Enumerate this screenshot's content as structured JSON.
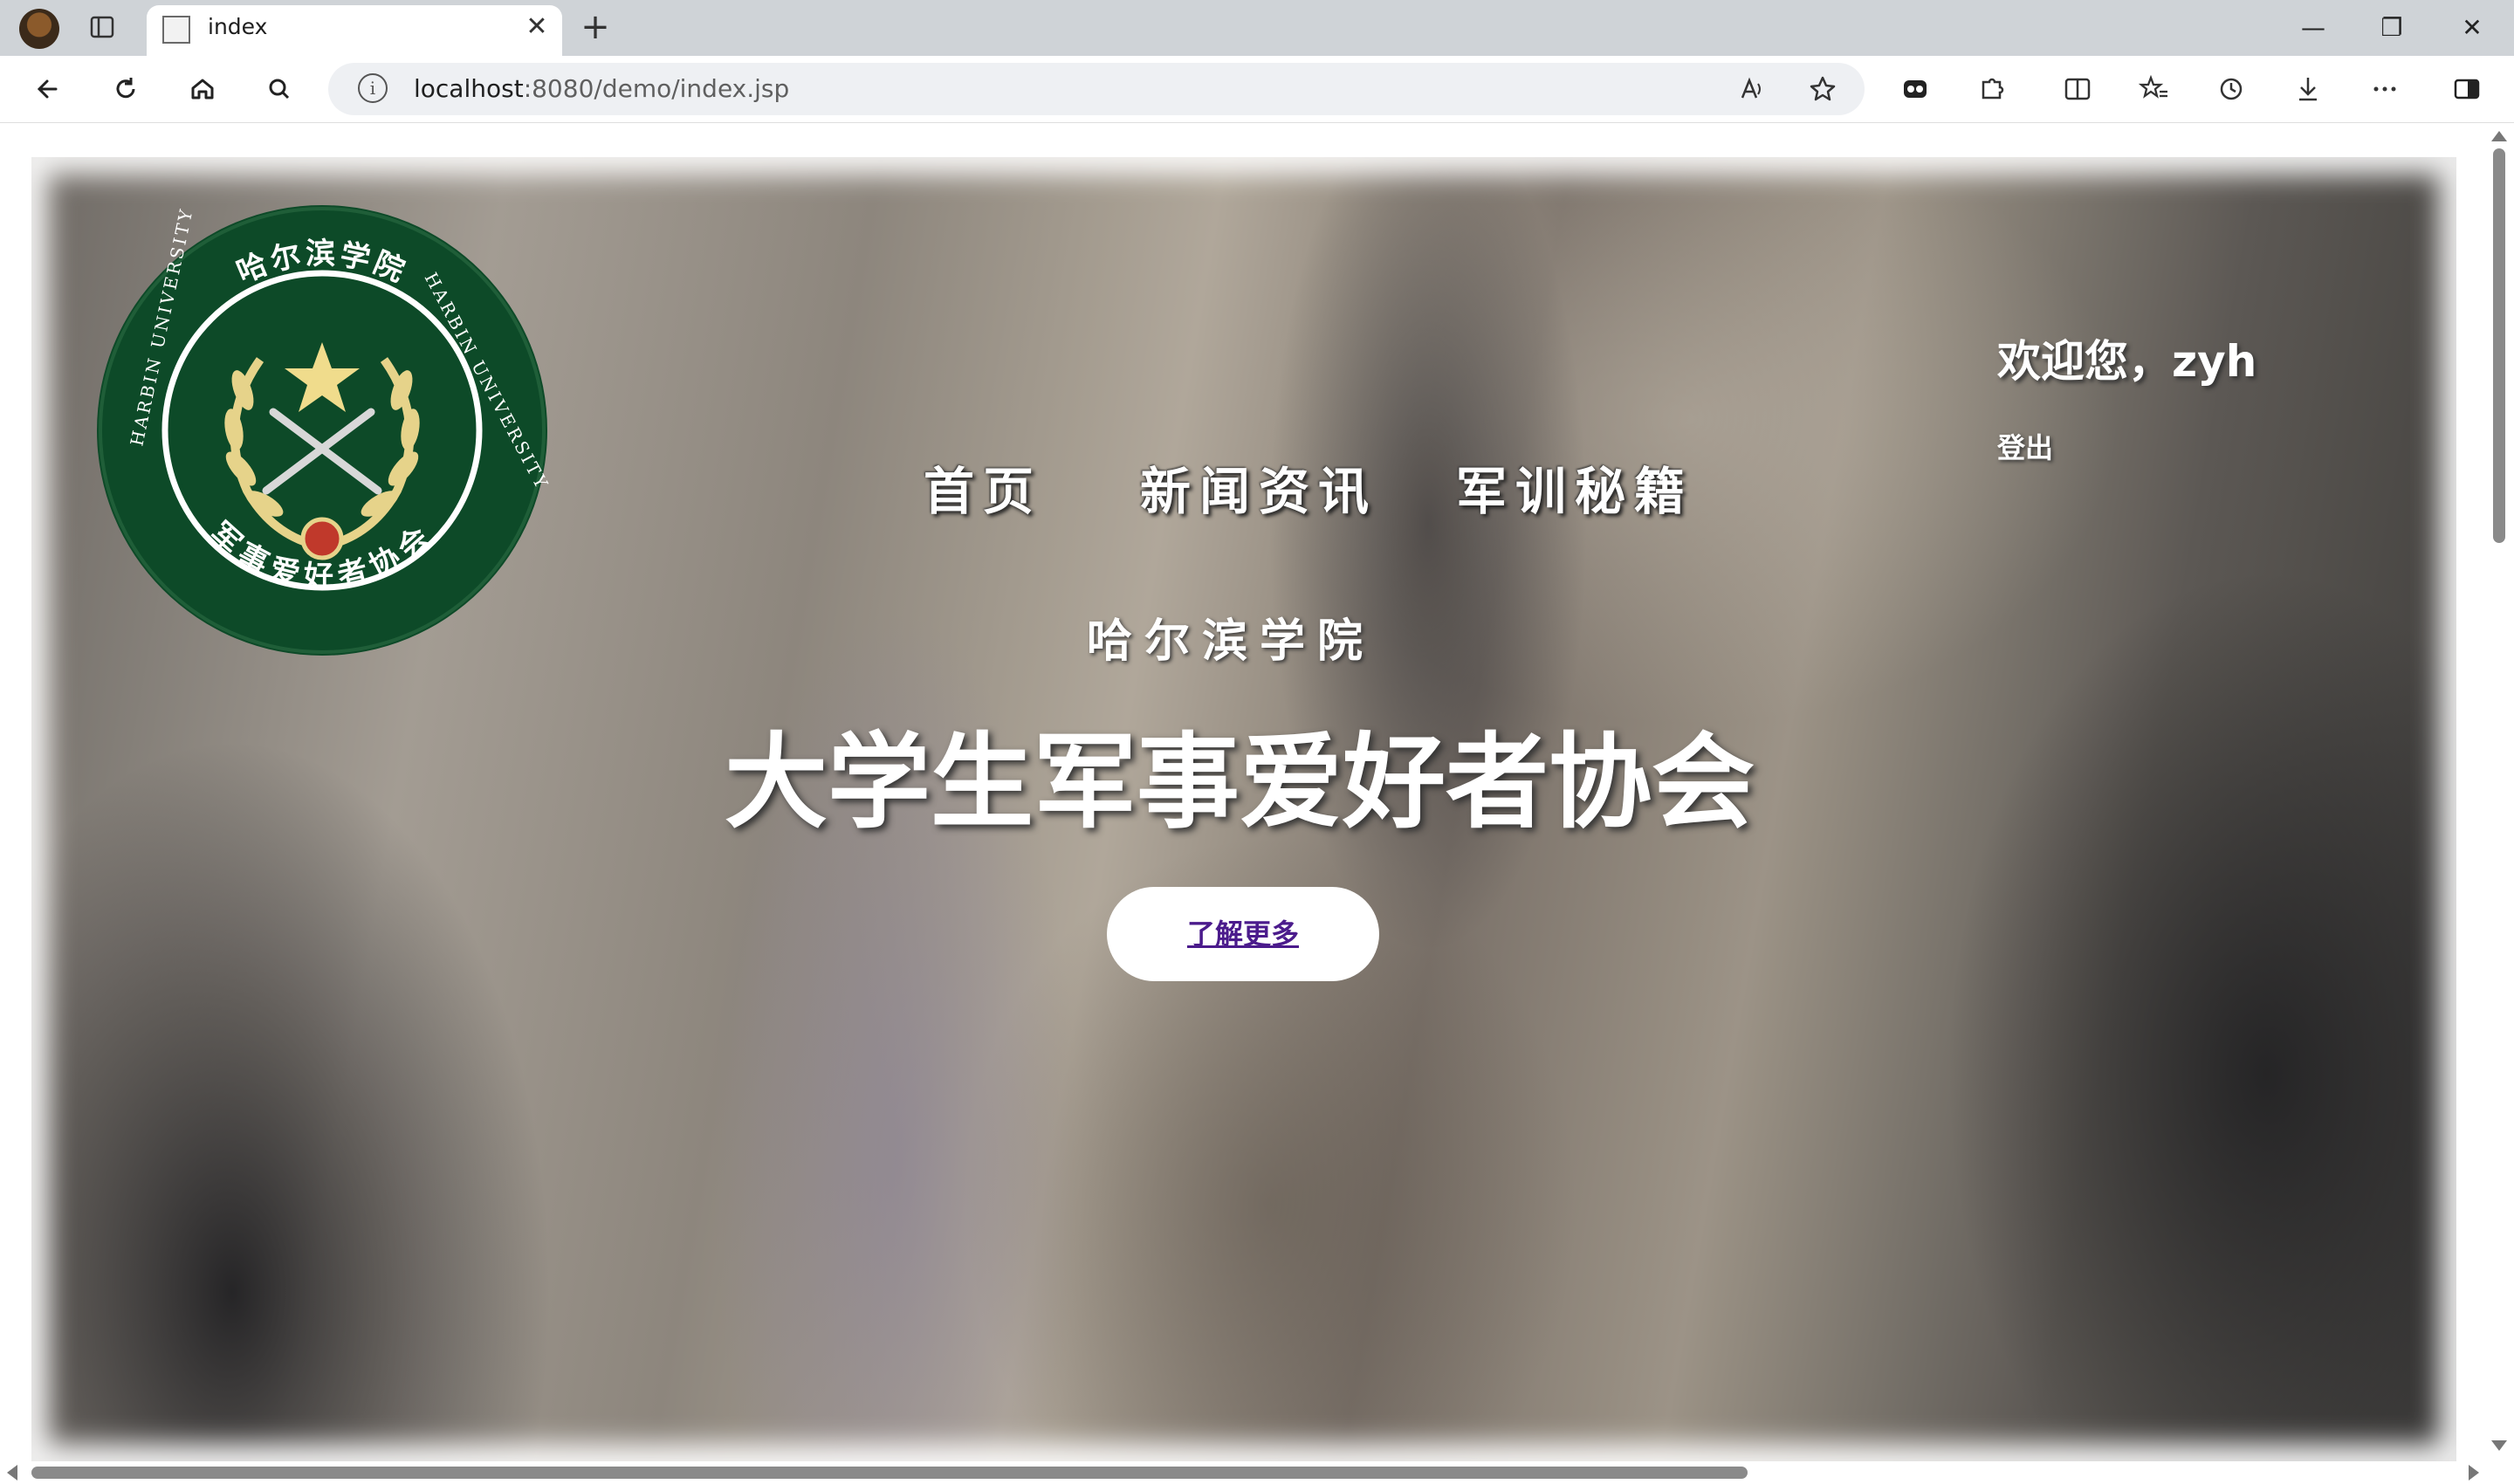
{
  "browser": {
    "tab_title": "index",
    "tab_close": "✕",
    "new_tab": "+",
    "url_host": "localhost",
    "url_path": ":8080/demo/index.jsp",
    "window_controls": {
      "minimize": "—",
      "restore": "❐",
      "close": "✕"
    },
    "icons": [
      "back-icon",
      "refresh-icon",
      "home-icon",
      "search-icon",
      "read-aloud-icon",
      "favorite-star-icon",
      "extensions-icon",
      "puzzle-icon",
      "split-screen-icon",
      "favorites-icon",
      "history-icon",
      "download-icon",
      "more-icon",
      "sidebar-icon"
    ]
  },
  "page": {
    "logo": {
      "top_text": "哈尔滨学院",
      "left_text": "HARBIN UNIVERSITY",
      "right_text": "HARBIN UNIVERSITY",
      "bottom_text": "军事爱好者协会"
    },
    "nav": {
      "home": "首页",
      "news": "新闻资讯",
      "training": "军训秘籍"
    },
    "user": {
      "welcome": "欢迎您，zyh",
      "logout": "登出"
    },
    "hero": {
      "subtitle": "哈尔滨学院",
      "headline": "大学生军事爱好者协会",
      "cta": "了解更多"
    },
    "colors": {
      "logo_green": "#0d4a28",
      "logo_gold": "#e6d38a",
      "cta_text": "#4b1b8c"
    }
  }
}
